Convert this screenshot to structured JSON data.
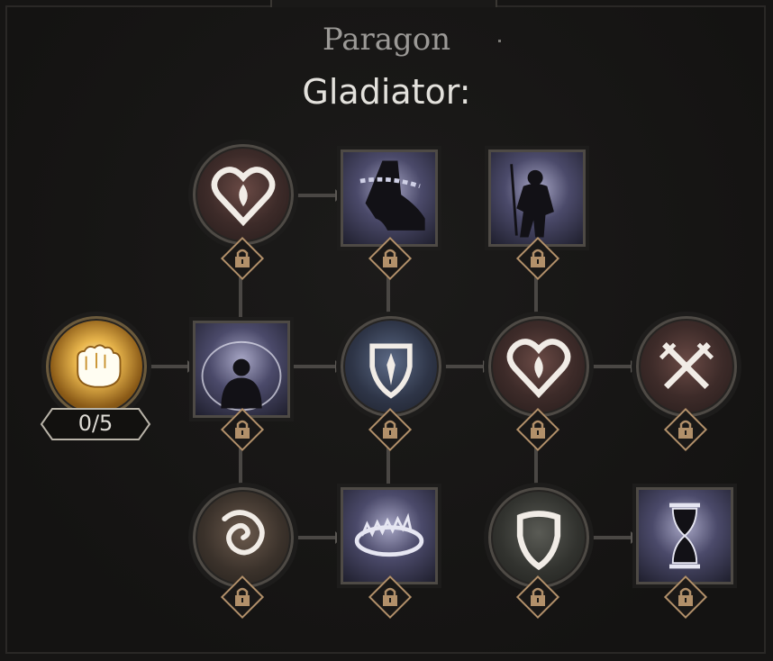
{
  "header": {
    "title": "Paragon",
    "subtitle": "Gladiator:"
  },
  "start_node": {
    "icon": "fist-icon",
    "points": "0/5"
  },
  "nodes": [
    {
      "icon": "heart-icon",
      "shape": "round",
      "locked": true
    },
    {
      "icon": "chained-boot-icon",
      "shape": "square",
      "locked": true
    },
    {
      "icon": "warrior-figure-icon",
      "shape": "square",
      "locked": true
    },
    {
      "icon": "aura-figure-icon",
      "shape": "square",
      "locked": true
    },
    {
      "icon": "shield-emblem-icon",
      "shape": "round",
      "locked": true
    },
    {
      "icon": "heart-icon",
      "shape": "round",
      "locked": true
    },
    {
      "icon": "crossed-swords-icon",
      "shape": "round",
      "locked": true
    },
    {
      "icon": "swirl-icon",
      "shape": "round",
      "locked": true
    },
    {
      "icon": "bear-trap-icon",
      "shape": "square",
      "locked": true
    },
    {
      "icon": "shield-icon",
      "shape": "round",
      "locked": true
    },
    {
      "icon": "hourglass-icon",
      "shape": "square",
      "locked": true
    }
  ],
  "colors": {
    "background": "#161514",
    "lock_accent": "#b2906a",
    "title": "#9c9a97",
    "subtitle": "#e3e1dc"
  }
}
